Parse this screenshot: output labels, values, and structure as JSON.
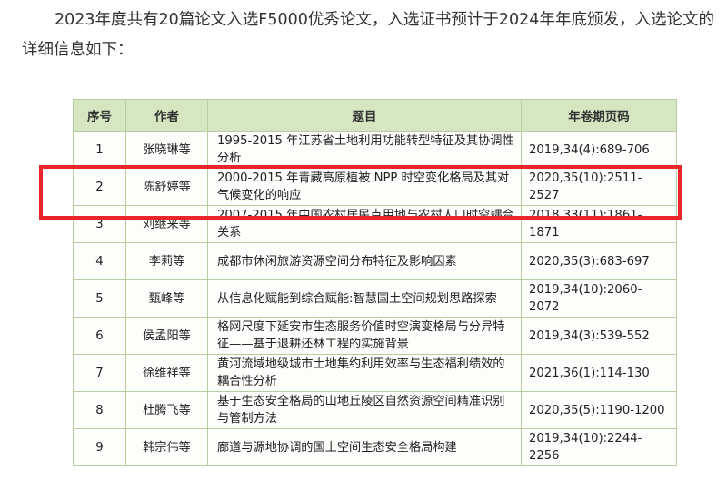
{
  "intro": {
    "text": "2023年度共有20篇论文入选F5000优秀论文，入选证书预计于2024年年底颁发，入选论文的详细信息如下："
  },
  "table": {
    "headers": [
      "序号",
      "作者",
      "题目",
      "年卷期页码"
    ],
    "rows": [
      {
        "num": "1",
        "author": "张晓琳等",
        "title": "1995-2015 年江苏省土地利用功能转型特征及其协调性分析",
        "pages": "2019,34(4):689-706"
      },
      {
        "num": "2",
        "author": "陈舒婷等",
        "title": "2000-2015 年青藏高原植被 NPP 时空变化格局及其对气候变化的响应",
        "pages": "2020,35(10):2511-2527"
      },
      {
        "num": "3",
        "author": "刘继来等",
        "title": "2007-2015 年中国农村居民点用地与农村人口时空耦合关系",
        "pages": "2018,33(11):1861-1871"
      },
      {
        "num": "4",
        "author": "李莉等",
        "title": "成都市休闲旅游资源空间分布特征及影响因素",
        "pages": "2020,35(3):683-697"
      },
      {
        "num": "5",
        "author": "甄峰等",
        "title": "从信息化赋能到综合赋能:智慧国土空间规划思路探索",
        "pages": "2019,34(10):2060-2072"
      },
      {
        "num": "6",
        "author": "侯孟阳等",
        "title": "格网尺度下延安市生态服务价值时空演变格局与分异特征——基于退耕还林工程的实施背景",
        "pages": "2019,34(3):539-552"
      },
      {
        "num": "7",
        "author": "徐维祥等",
        "title": "黄河流域地级城市土地集约利用效率与生态福利绩效的耦合性分析",
        "pages": "2021,36(1):114-130"
      },
      {
        "num": "8",
        "author": "杜腾飞等",
        "title": "基于生态安全格局的山地丘陵区自然资源空间精准识别与管制方法",
        "pages": "2020,35(5):1190-1200"
      },
      {
        "num": "9",
        "author": "韩宗伟等",
        "title": "廊道与源地协调的国土空间生态安全格局构建",
        "pages": "2019,34(10):2244-2256"
      }
    ]
  },
  "highlight": {
    "color": "#e8252a",
    "row": "2"
  },
  "colors": {
    "header_bg": "#d5e6c0",
    "border": "#b7cfa0"
  }
}
